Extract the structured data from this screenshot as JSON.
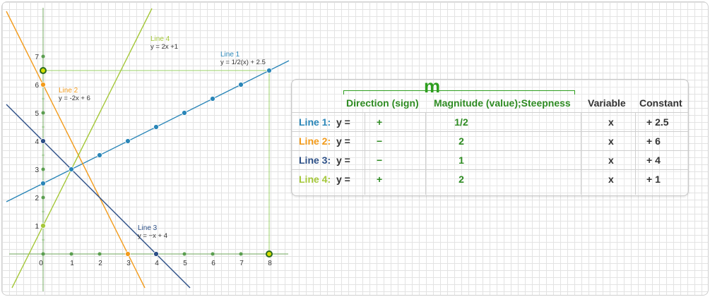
{
  "graph": {
    "x_ticks": [
      "0",
      "1",
      "2",
      "3",
      "4",
      "5",
      "6",
      "7",
      "8"
    ],
    "y_ticks": [
      "1",
      "2",
      "3",
      "4",
      "5",
      "6",
      "7"
    ],
    "x_range": [
      -1.3,
      8.7
    ],
    "y_range": [
      -1.2,
      8.7
    ],
    "lines": [
      {
        "id": "line-1",
        "label": "Line 1",
        "equation": "y = 1/2(x) + 2.5",
        "slope": 0.5,
        "intercept": 2.5,
        "color": "#2a86b8",
        "points": [
          [
            0,
            2.5
          ],
          [
            1,
            3
          ],
          [
            2,
            3.5
          ],
          [
            3,
            4
          ],
          [
            4,
            4.5
          ],
          [
            5,
            5
          ],
          [
            6,
            5.5
          ],
          [
            7,
            6
          ],
          [
            8,
            6.5
          ]
        ]
      },
      {
        "id": "line-2",
        "label": "Line 2",
        "equation": "y = -2x + 6",
        "slope": -2,
        "intercept": 6,
        "color": "#f39b1a",
        "points": [
          [
            0,
            6
          ],
          [
            3,
            0
          ]
        ]
      },
      {
        "id": "line-3",
        "label": "Line 3",
        "equation": "y = −x + 4",
        "slope": -1,
        "intercept": 4,
        "color": "#2c4f86",
        "points": [
          [
            0,
            4
          ],
          [
            4,
            0
          ]
        ]
      },
      {
        "id": "line-4",
        "label": "Line 4",
        "equation": "y = 2x +1",
        "slope": 2,
        "intercept": 1,
        "color": "#a5c83a",
        "points": [
          [
            0,
            1
          ]
        ]
      }
    ],
    "axis_dot_color": "#5a9e4f",
    "highlight_points": [
      [
        0,
        6.5
      ],
      [
        8,
        0
      ]
    ],
    "highlight_fill": "#d4e000",
    "highlight_stroke": "#2b6b1f"
  },
  "table": {
    "m_label": "m",
    "headers": {
      "direction": "Direction (sign)",
      "magnitude": "Magnitude (value);Steepness",
      "variable": "Variable",
      "constant": "Constant"
    },
    "rows": [
      {
        "name": "Line 1:",
        "color": "#2a86b8",
        "y": "y =",
        "sign": "+",
        "magnitude": "1/2",
        "variable": "x",
        "constant": "+ 2.5"
      },
      {
        "name": "Line 2:",
        "color": "#f39b1a",
        "y": "y =",
        "sign": "−",
        "magnitude": "2",
        "variable": "x",
        "constant": "+ 6"
      },
      {
        "name": "Line 3:",
        "color": "#2c4f86",
        "y": "y =",
        "sign": "−",
        "magnitude": "1",
        "variable": "x",
        "constant": "+ 4"
      },
      {
        "name": "Line 4:",
        "color": "#a5c83a",
        "y": "y =",
        "sign": "+",
        "magnitude": "2",
        "variable": "x",
        "constant": "+ 1"
      }
    ]
  }
}
